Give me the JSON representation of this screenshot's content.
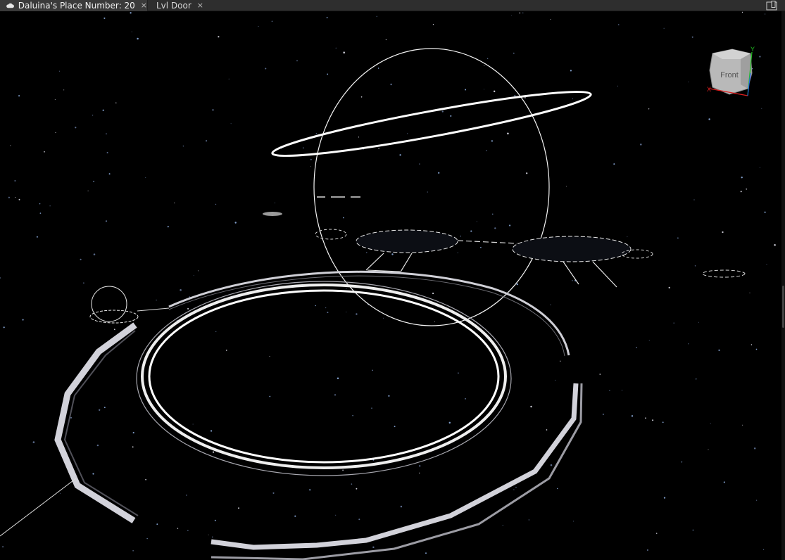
{
  "tabs": [
    {
      "label": "Daluina's Place Number: 20",
      "active": true,
      "icon": "cloud-icon"
    },
    {
      "label": "Lvl Door",
      "active": false
    }
  ],
  "tab_close_glyph": "×",
  "view_cube": {
    "face_label": "Front",
    "axis_x": "X",
    "axis_y": "Y"
  },
  "colors": {
    "tabbar_bg": "#2e2e2e",
    "viewport_bg": "#000000",
    "wireframe": "#ffffff",
    "axis_x": "#e02020",
    "axis_y": "#20c020",
    "axis_z": "#2060ff"
  }
}
